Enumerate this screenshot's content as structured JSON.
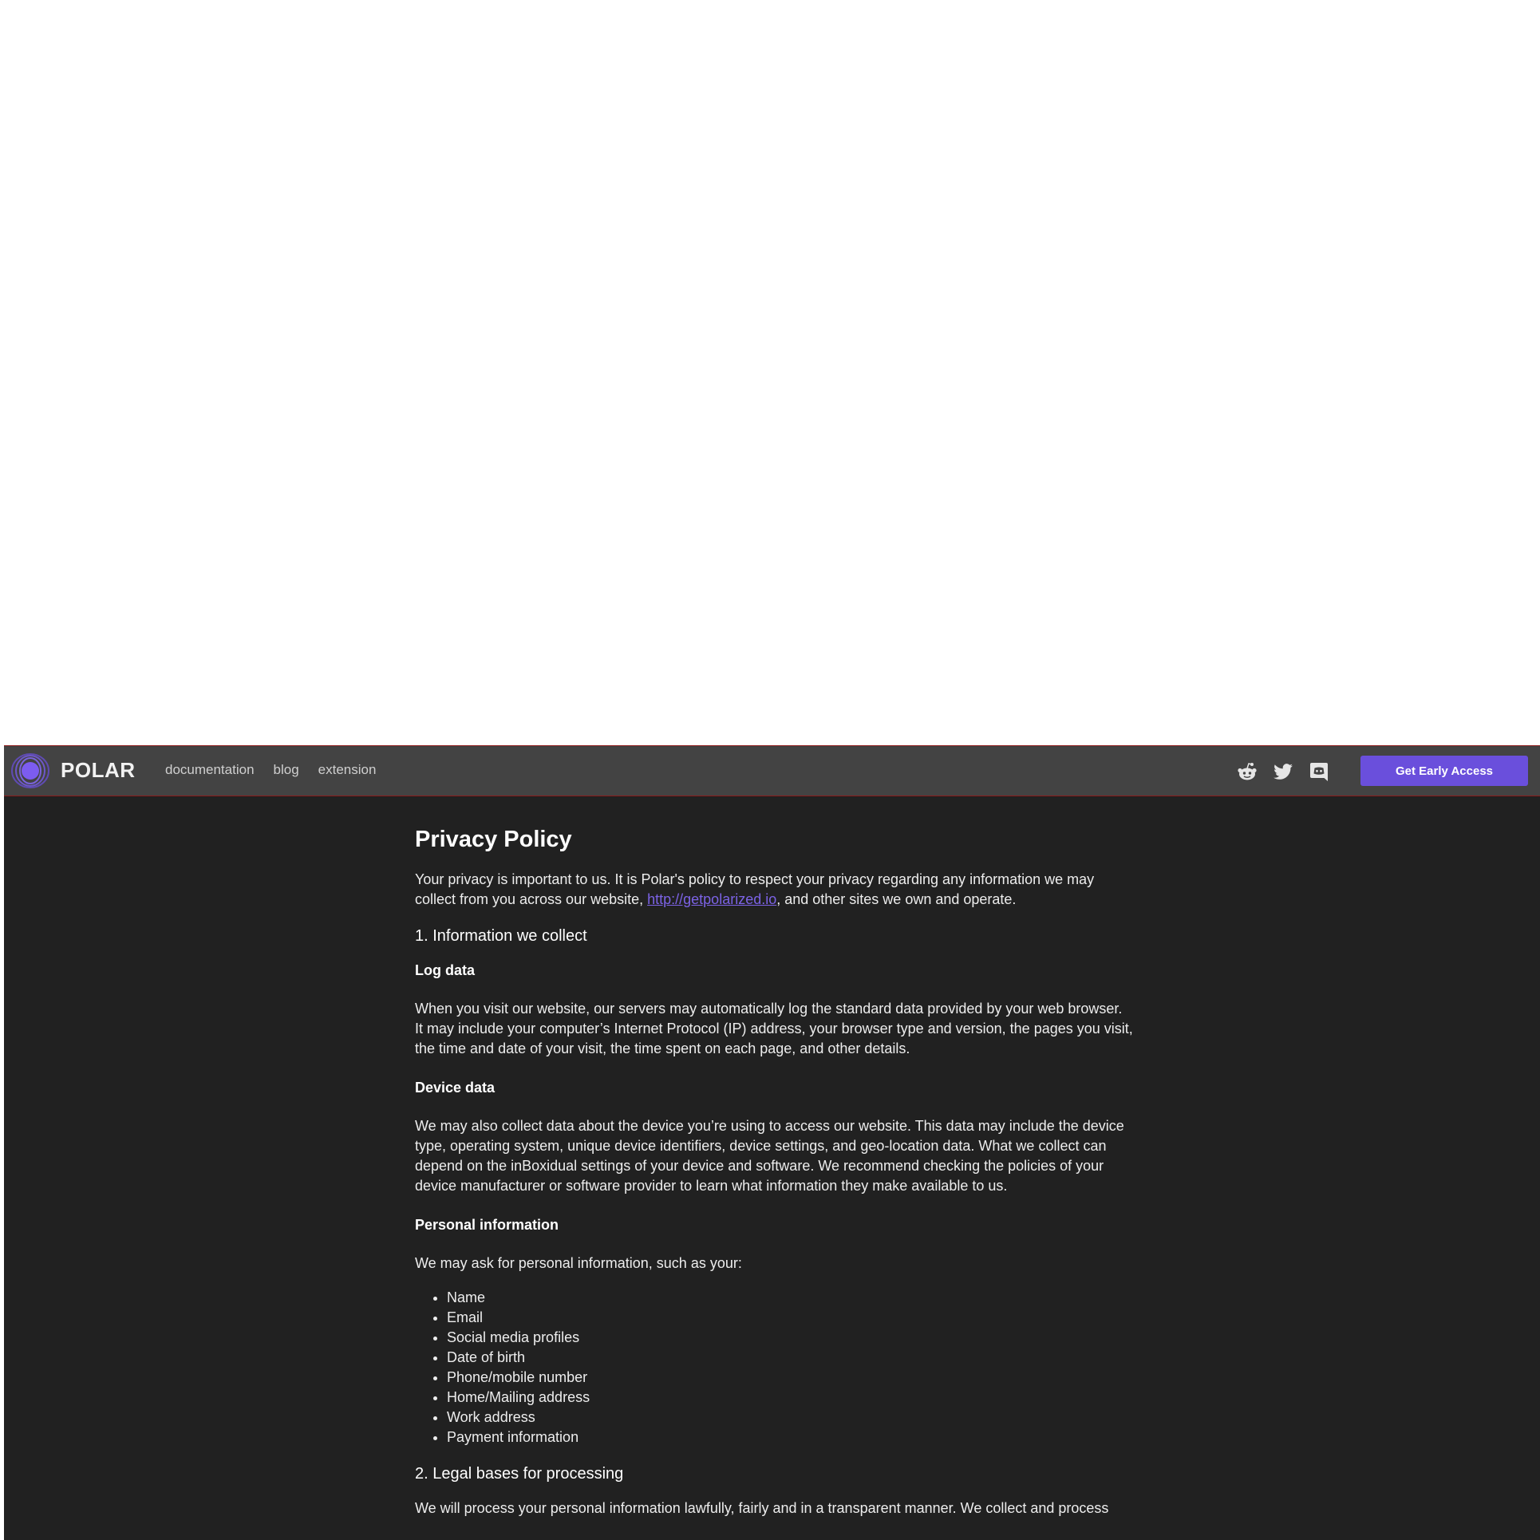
{
  "nav": {
    "brand": "POLAR",
    "links": [
      "documentation",
      "blog",
      "extension"
    ],
    "cta_label": "Get Early Access",
    "social_icons": [
      "reddit-icon",
      "twitter-icon",
      "discord-icon"
    ],
    "accent_color": "#6a4fdc"
  },
  "page": {
    "title": "Privacy Policy",
    "intro_before_link": "Your privacy is important to us. It is Polar's policy to respect your privacy regarding any information we may collect from you across our website, ",
    "intro_link": "http://getpolarized.io",
    "intro_after_link": ", and other sites we own and operate.",
    "section1_heading": "1. Information we collect",
    "log_data_heading": "Log data",
    "log_data_text": "When you visit our website, our servers may automatically log the standard data provided by your web browser. It may include your computer’s Internet Protocol (IP) address, your browser type and version, the pages you visit, the time and date of your visit, the time spent on each page, and other details.",
    "device_data_heading": "Device data",
    "device_data_text": "We may also collect data about the device you’re using to access our website. This data may include the device type, operating system, unique device identifiers, device settings, and geo-location data. What we collect can depend on the inBoxidual settings of your device and software. We recommend checking the policies of your device manufacturer or software provider to learn what information they make available to us.",
    "personal_info_heading": "Personal information",
    "personal_info_text": "We may ask for personal information, such as your:",
    "personal_info_items": [
      "Name",
      "Email",
      "Social media profiles",
      "Date of birth",
      "Phone/mobile number",
      "Home/Mailing address",
      "Work address",
      "Payment information"
    ],
    "section2_heading": "2. Legal bases for processing",
    "section2_text": "We will process your personal information lawfully, fairly and in a transparent manner. We collect and process"
  }
}
